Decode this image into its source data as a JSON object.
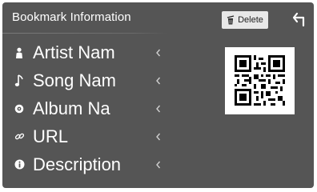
{
  "header": {
    "title": "Bookmark Information",
    "delete_label": "Delete"
  },
  "icons": {
    "delete": "trash-icon",
    "back": "back-arrow-icon"
  },
  "items": [
    {
      "label": "Artist Nam",
      "icon": "person-icon"
    },
    {
      "label": "Song Nam",
      "icon": "music-note-icon"
    },
    {
      "label": "Album Na",
      "icon": "disc-icon"
    },
    {
      "label": "URL",
      "icon": "link-icon"
    },
    {
      "label": "Description",
      "icon": "info-icon"
    }
  ],
  "colors": {
    "background": "#555555",
    "text": "#ffffff",
    "button": "#e8e8e8"
  }
}
